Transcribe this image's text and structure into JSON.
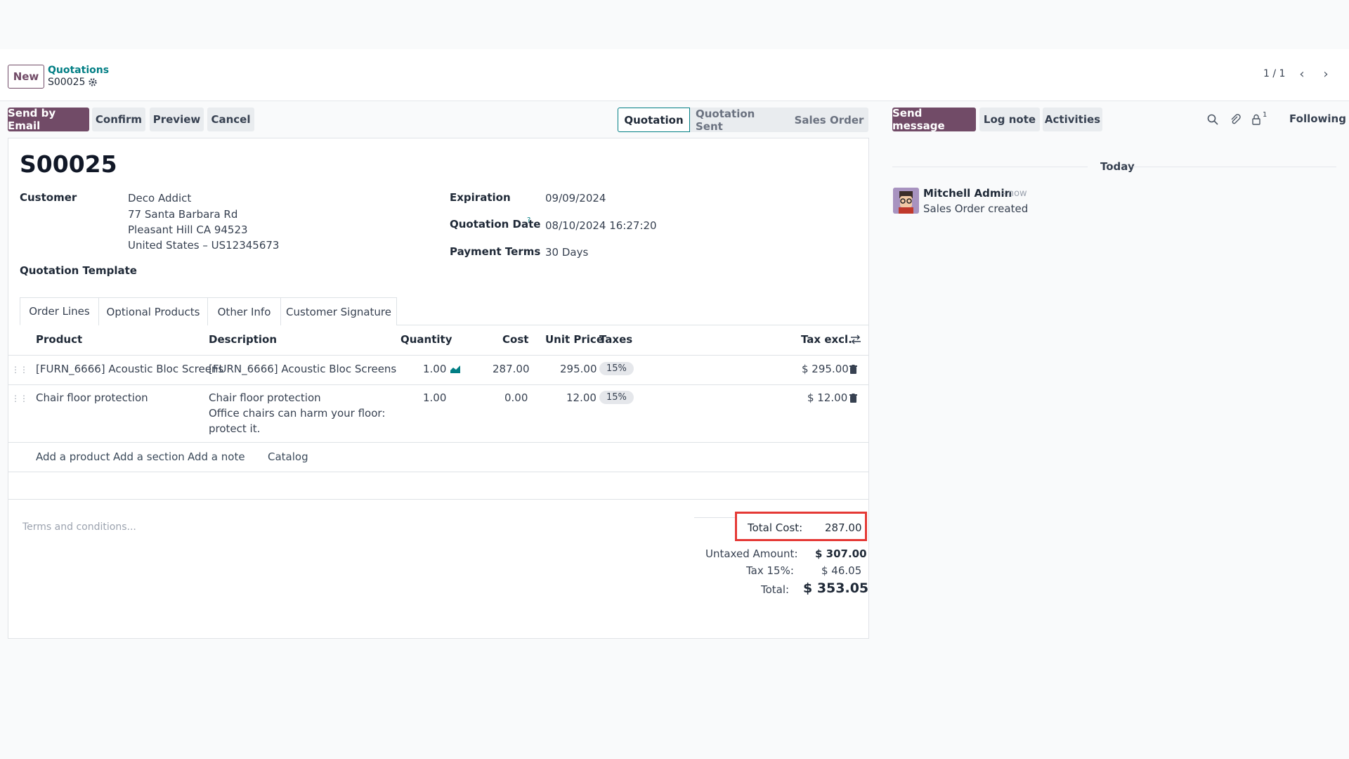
{
  "header": {
    "new_label": "New",
    "breadcrumb_parent": "Quotations",
    "record_name": "S00025",
    "pager": "1 / 1"
  },
  "toolbar": {
    "send_email": "Send by Email",
    "confirm": "Confirm",
    "preview": "Preview",
    "cancel": "Cancel"
  },
  "statusbar": {
    "stages": [
      "Quotation",
      "Quotation Sent",
      "Sales Order"
    ],
    "active": "Quotation"
  },
  "chatter": {
    "send_message": "Send message",
    "log_note": "Log note",
    "activities": "Activities",
    "followers_count": "1",
    "following": "Following",
    "date_separator": "Today",
    "message": {
      "author": "Mitchell Admin",
      "time": "- now",
      "body": "Sales Order created"
    }
  },
  "form": {
    "title": "S00025",
    "customer_label": "Customer",
    "customer_name": "Deco Addict",
    "address_line1": "77 Santa Barbara Rd",
    "address_line2": "Pleasant Hill CA 94523",
    "address_line3": "United States – US12345673",
    "template_label": "Quotation Template",
    "expiration_label": "Expiration",
    "expiration_value": "09/09/2024",
    "quotation_date_label": "Quotation Date",
    "quotation_date_help": "?",
    "quotation_date_value": "08/10/2024 16:27:20",
    "payment_terms_label": "Payment Terms",
    "payment_terms_value": "30 Days"
  },
  "tabs": [
    "Order Lines",
    "Optional Products",
    "Other Info",
    "Customer Signature"
  ],
  "table": {
    "columns": {
      "product": "Product",
      "description": "Description",
      "quantity": "Quantity",
      "cost": "Cost",
      "unit_price": "Unit Price",
      "taxes": "Taxes",
      "tax_excl": "Tax excl."
    },
    "rows": [
      {
        "product": "[FURN_6666] Acoustic Bloc Screens",
        "description": "[FURN_6666] Acoustic Bloc Screens",
        "description_extra": "",
        "quantity": "1.00",
        "cost": "287.00",
        "unit_price": "295.00",
        "tax": "15%",
        "subtotal": "$ 295.00"
      },
      {
        "product": "Chair floor protection",
        "description": "Chair floor protection",
        "description_extra": "Office chairs can harm your floor:",
        "description_extra2": "protect it.",
        "quantity": "1.00",
        "cost": "0.00",
        "unit_price": "12.00",
        "tax": "15%",
        "subtotal": "$ 12.00"
      }
    ],
    "add_product": "Add a product",
    "add_section": "Add a section",
    "add_note": "Add a note",
    "catalog": "Catalog"
  },
  "footer": {
    "terms_placeholder": "Terms and conditions...",
    "total_cost_label": "Total Cost:",
    "total_cost_value": "287.00",
    "untaxed_label": "Untaxed Amount:",
    "untaxed_value": "$ 307.00",
    "tax_label": "Tax 15%:",
    "tax_value": "$ 46.05",
    "total_label": "Total:",
    "total_value": "$ 353.05"
  },
  "colors": {
    "primary": "#714b67",
    "highlight_border": "#e53935"
  }
}
